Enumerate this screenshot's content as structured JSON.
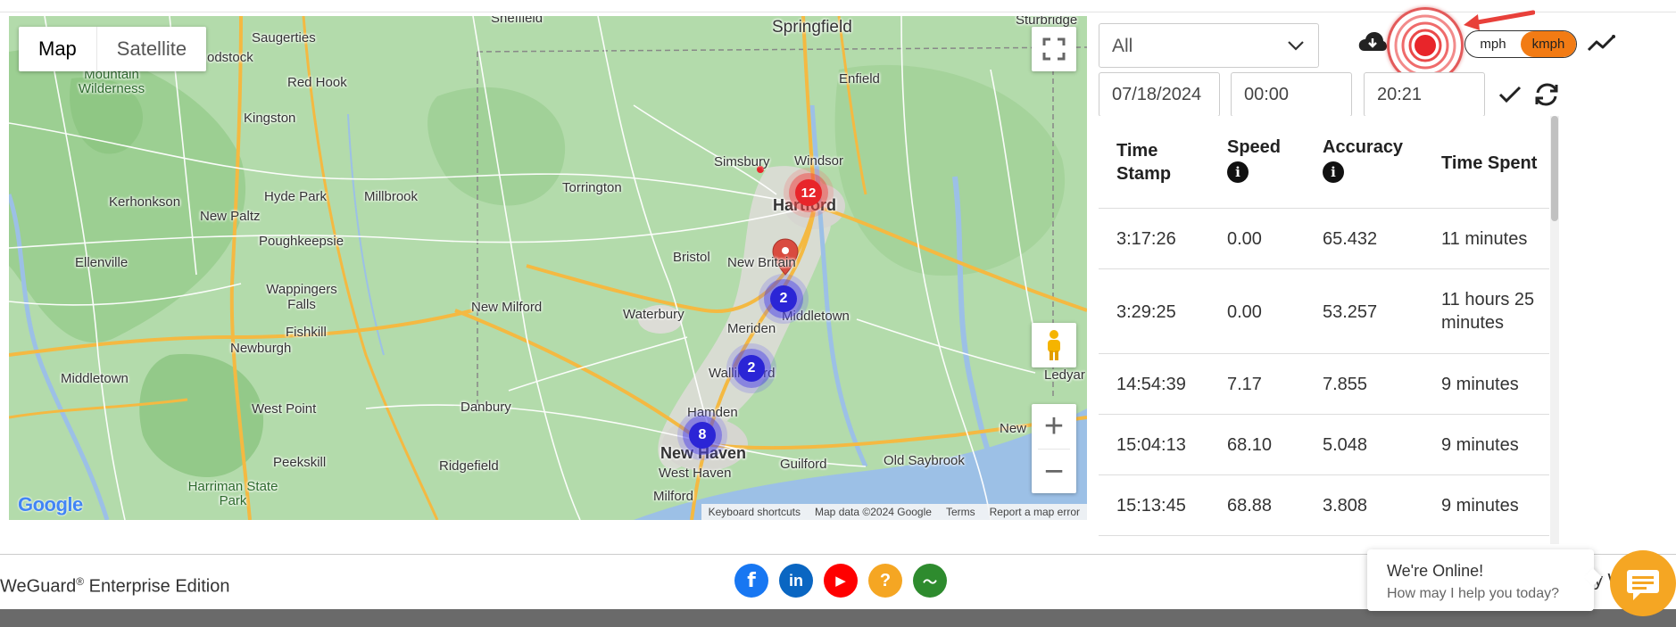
{
  "map": {
    "type_control": {
      "map": "Map",
      "satellite": "Satellite"
    },
    "places": [
      {
        "label": "Sheffield"
      },
      {
        "label": "Springfield"
      },
      {
        "label": "Sturbridge"
      },
      {
        "label": "Saugerties"
      },
      {
        "label": "odstock"
      },
      {
        "label": "Mountain Wilderness"
      },
      {
        "label": "Red Hook"
      },
      {
        "label": "Enfield"
      },
      {
        "label": "Kingston"
      },
      {
        "label": "Simsbury"
      },
      {
        "label": "Windsor"
      },
      {
        "label": "Torrington"
      },
      {
        "label": "Hartford"
      },
      {
        "label": "Kerhonkson"
      },
      {
        "label": "Hyde Park"
      },
      {
        "label": "Millbrook"
      },
      {
        "label": "New Paltz"
      },
      {
        "label": "Poughkeepsie"
      },
      {
        "label": "Ellenville"
      },
      {
        "label": "Bristol"
      },
      {
        "label": "New Britain"
      },
      {
        "label": "Wappingers Falls"
      },
      {
        "label": "Waterbury"
      },
      {
        "label": "Middletown"
      },
      {
        "label": "New Milford"
      },
      {
        "label": "Fishkill"
      },
      {
        "label": "Meriden"
      },
      {
        "label": "Newburgh"
      },
      {
        "label": "Wallingford"
      },
      {
        "label": "Middletown"
      },
      {
        "label": "West Point"
      },
      {
        "label": "Danbury"
      },
      {
        "label": "Hamden"
      },
      {
        "label": "Ledyar"
      },
      {
        "label": "Peekskill"
      },
      {
        "label": "Ridgefield"
      },
      {
        "label": "New Haven"
      },
      {
        "label": "West Haven"
      },
      {
        "label": "Guilford"
      },
      {
        "label": "Old Saybrook"
      },
      {
        "label": "New"
      },
      {
        "label": "Harriman State Park"
      },
      {
        "label": "Milford"
      }
    ],
    "clusters": [
      {
        "count": "12",
        "color": "red"
      },
      {
        "count": "2",
        "color": "blue"
      },
      {
        "count": "2",
        "color": "blue"
      },
      {
        "count": "8",
        "color": "blue"
      }
    ],
    "attribution": {
      "shortcuts": "Keyboard shortcuts",
      "data": "Map data ©2024 Google",
      "terms": "Terms",
      "report": "Report a map error"
    },
    "logo": "Google"
  },
  "controls": {
    "select_value": "All",
    "unit_mph": "mph",
    "unit_kmph": "kmph",
    "active_unit": "kmph",
    "date": "07/18/2024",
    "start_time": "00:00",
    "end_time": "20:21",
    "accent": "#f27b14"
  },
  "table": {
    "headers": {
      "timestamp": "Time Stamp",
      "speed": "Speed",
      "accuracy": "Accuracy",
      "time_spent": "Time Spent"
    },
    "info_glyph": "i",
    "rows": [
      {
        "timestamp": "3:17:26",
        "speed": "0.00",
        "accuracy": "65.432",
        "time_spent": "11 minutes"
      },
      {
        "timestamp": "3:29:25",
        "speed": "0.00",
        "accuracy": "53.257",
        "time_spent": "11 hours 25 minutes"
      },
      {
        "timestamp": "14:54:39",
        "speed": "7.17",
        "accuracy": "7.855",
        "time_spent": "9 minutes"
      },
      {
        "timestamp": "15:04:13",
        "speed": "68.10",
        "accuracy": "5.048",
        "time_spent": "9 minutes"
      },
      {
        "timestamp": "15:13:45",
        "speed": "68.88",
        "accuracy": "3.808",
        "time_spent": "9 minutes"
      }
    ]
  },
  "footer": {
    "brand": "WeGuard",
    "reg": "®",
    "edition": " Enterprise Edition",
    "social": [
      {
        "name": "facebook",
        "glyph": "f",
        "color": "#1877f2"
      },
      {
        "name": "linkedin",
        "glyph": "in",
        "color": "#0a66c2"
      },
      {
        "name": "youtube",
        "glyph": "▶",
        "color": "#ff0000"
      },
      {
        "name": "help",
        "glyph": "?",
        "color": "#f5a623"
      },
      {
        "name": "pulse",
        "glyph": "〜",
        "color": "#2e8b2e"
      }
    ],
    "chat_title": "We're Online!",
    "chat_subtitle": "How may I help you today?",
    "chat_behind": "y W"
  }
}
